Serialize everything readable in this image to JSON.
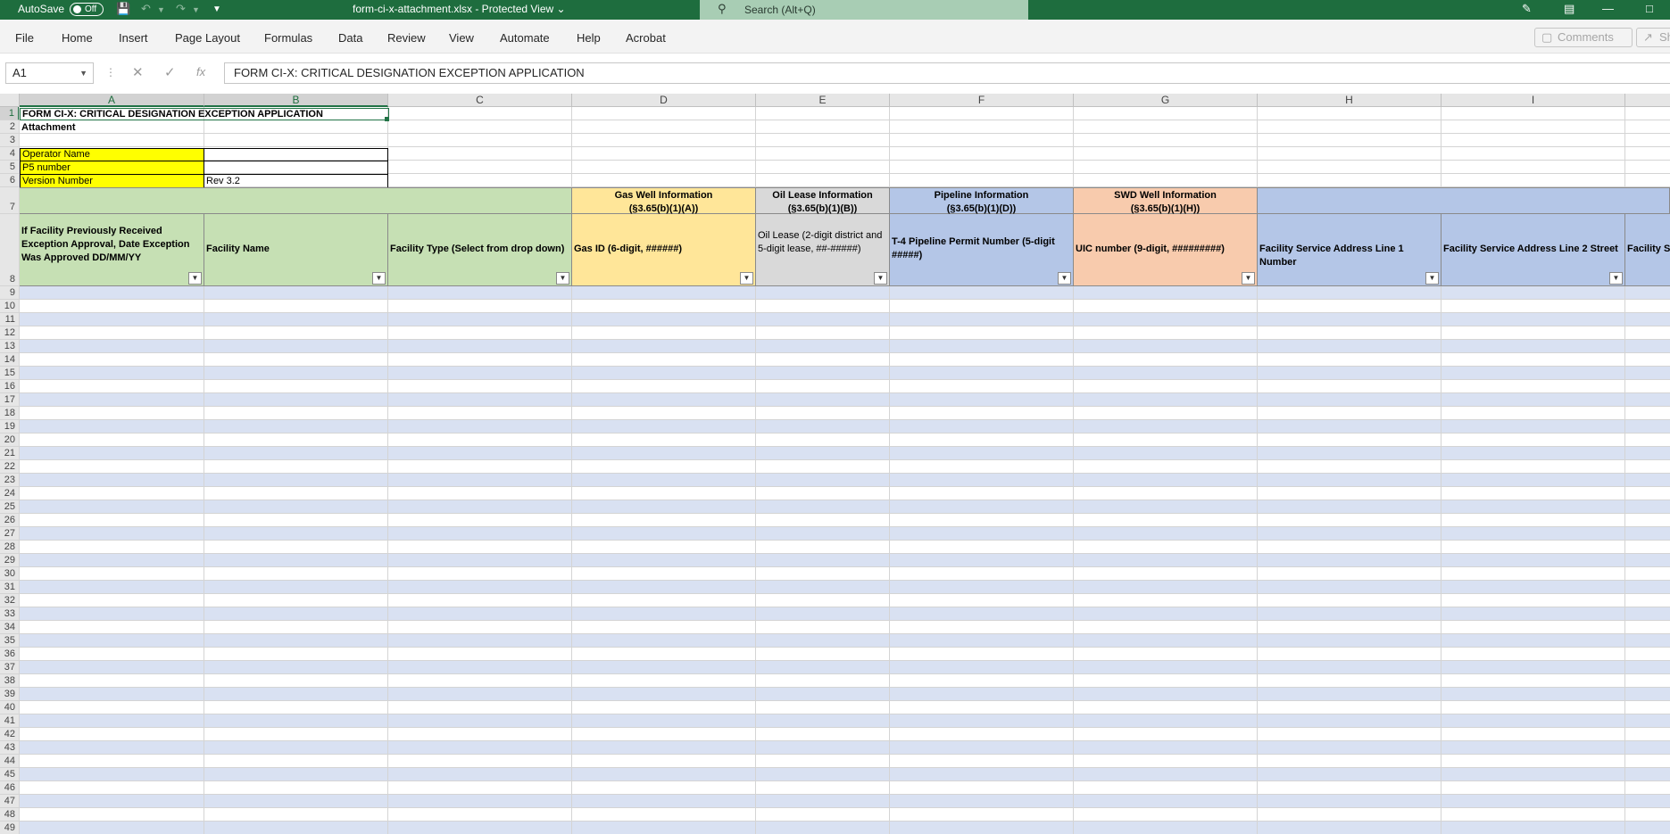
{
  "titlebar": {
    "autosave_label": "AutoSave",
    "autosave_state": "Off",
    "document_title": "form-ci-x-attachment.xlsx  -  Protected View ⌄",
    "search_placeholder": "Search (Alt+Q)"
  },
  "ribbon": {
    "tabs": [
      "File",
      "Home",
      "Insert",
      "Page Layout",
      "Formulas",
      "Data",
      "Review",
      "View",
      "Automate",
      "Help",
      "Acrobat"
    ],
    "comments_label": "Comments",
    "share_label": "Sha"
  },
  "formula_bar": {
    "name_box": "A1",
    "content": "FORM CI-X: CRITICAL DESIGNATION EXCEPTION APPLICATION"
  },
  "sheet": {
    "columns": [
      "A",
      "B",
      "C",
      "D",
      "E",
      "F",
      "G",
      "H",
      "I"
    ],
    "rows_visible": [
      "1",
      "2",
      "3",
      "4",
      "5",
      "6",
      "7",
      "8",
      "9",
      "10",
      "11",
      "12",
      "13",
      "14",
      "15",
      "16",
      "17",
      "18",
      "19",
      "20",
      "21",
      "22",
      "23",
      "24",
      "25",
      "26",
      "27",
      "28",
      "29",
      "30",
      "31",
      "32",
      "33",
      "34",
      "35",
      "36",
      "37",
      "38",
      "39",
      "40",
      "41",
      "42",
      "43",
      "44",
      "45",
      "46",
      "47",
      "48",
      "49"
    ],
    "a1": "FORM CI-X: CRITICAL DESIGNATION EXCEPTION APPLICATION",
    "a2": "Attachment",
    "a4": "Operator Name",
    "a5": "P5 number",
    "a6": "Version Number",
    "b6": "Rev 3.2",
    "groups": {
      "gas_well": "Gas Well Information",
      "gas_well_ref": "(§3.65(b)(1)(A))",
      "oil_lease": "Oil Lease Information",
      "oil_lease_ref": "(§3.65(b)(1)(B))",
      "pipeline": "Pipeline Information",
      "pipeline_ref": "(§3.65(b)(1)(D))",
      "swd_well": "SWD Well Information",
      "swd_well_ref": "(§3.65(b)(1)(H))"
    },
    "headers": {
      "a8": "If Facility Previously Received Exception Approval, Date Exception Was Approved DD/MM/YY",
      "b8": "Facility Name",
      "c8": "Facility Type (Select from drop down)",
      "d8": "Gas ID (6-digit, ######)",
      "e8": "Oil Lease (2-digit district and 5-digit lease, ##-#####)",
      "f8": "T-4 Pipeline Permit Number (5-digit #####)",
      "g8": "UIC number (9-digit, #########)",
      "h8": "Facility Service Address Line 1 Number",
      "i8": "Facility Service Address Line 2 Street",
      "j8": "Facility Se"
    }
  }
}
